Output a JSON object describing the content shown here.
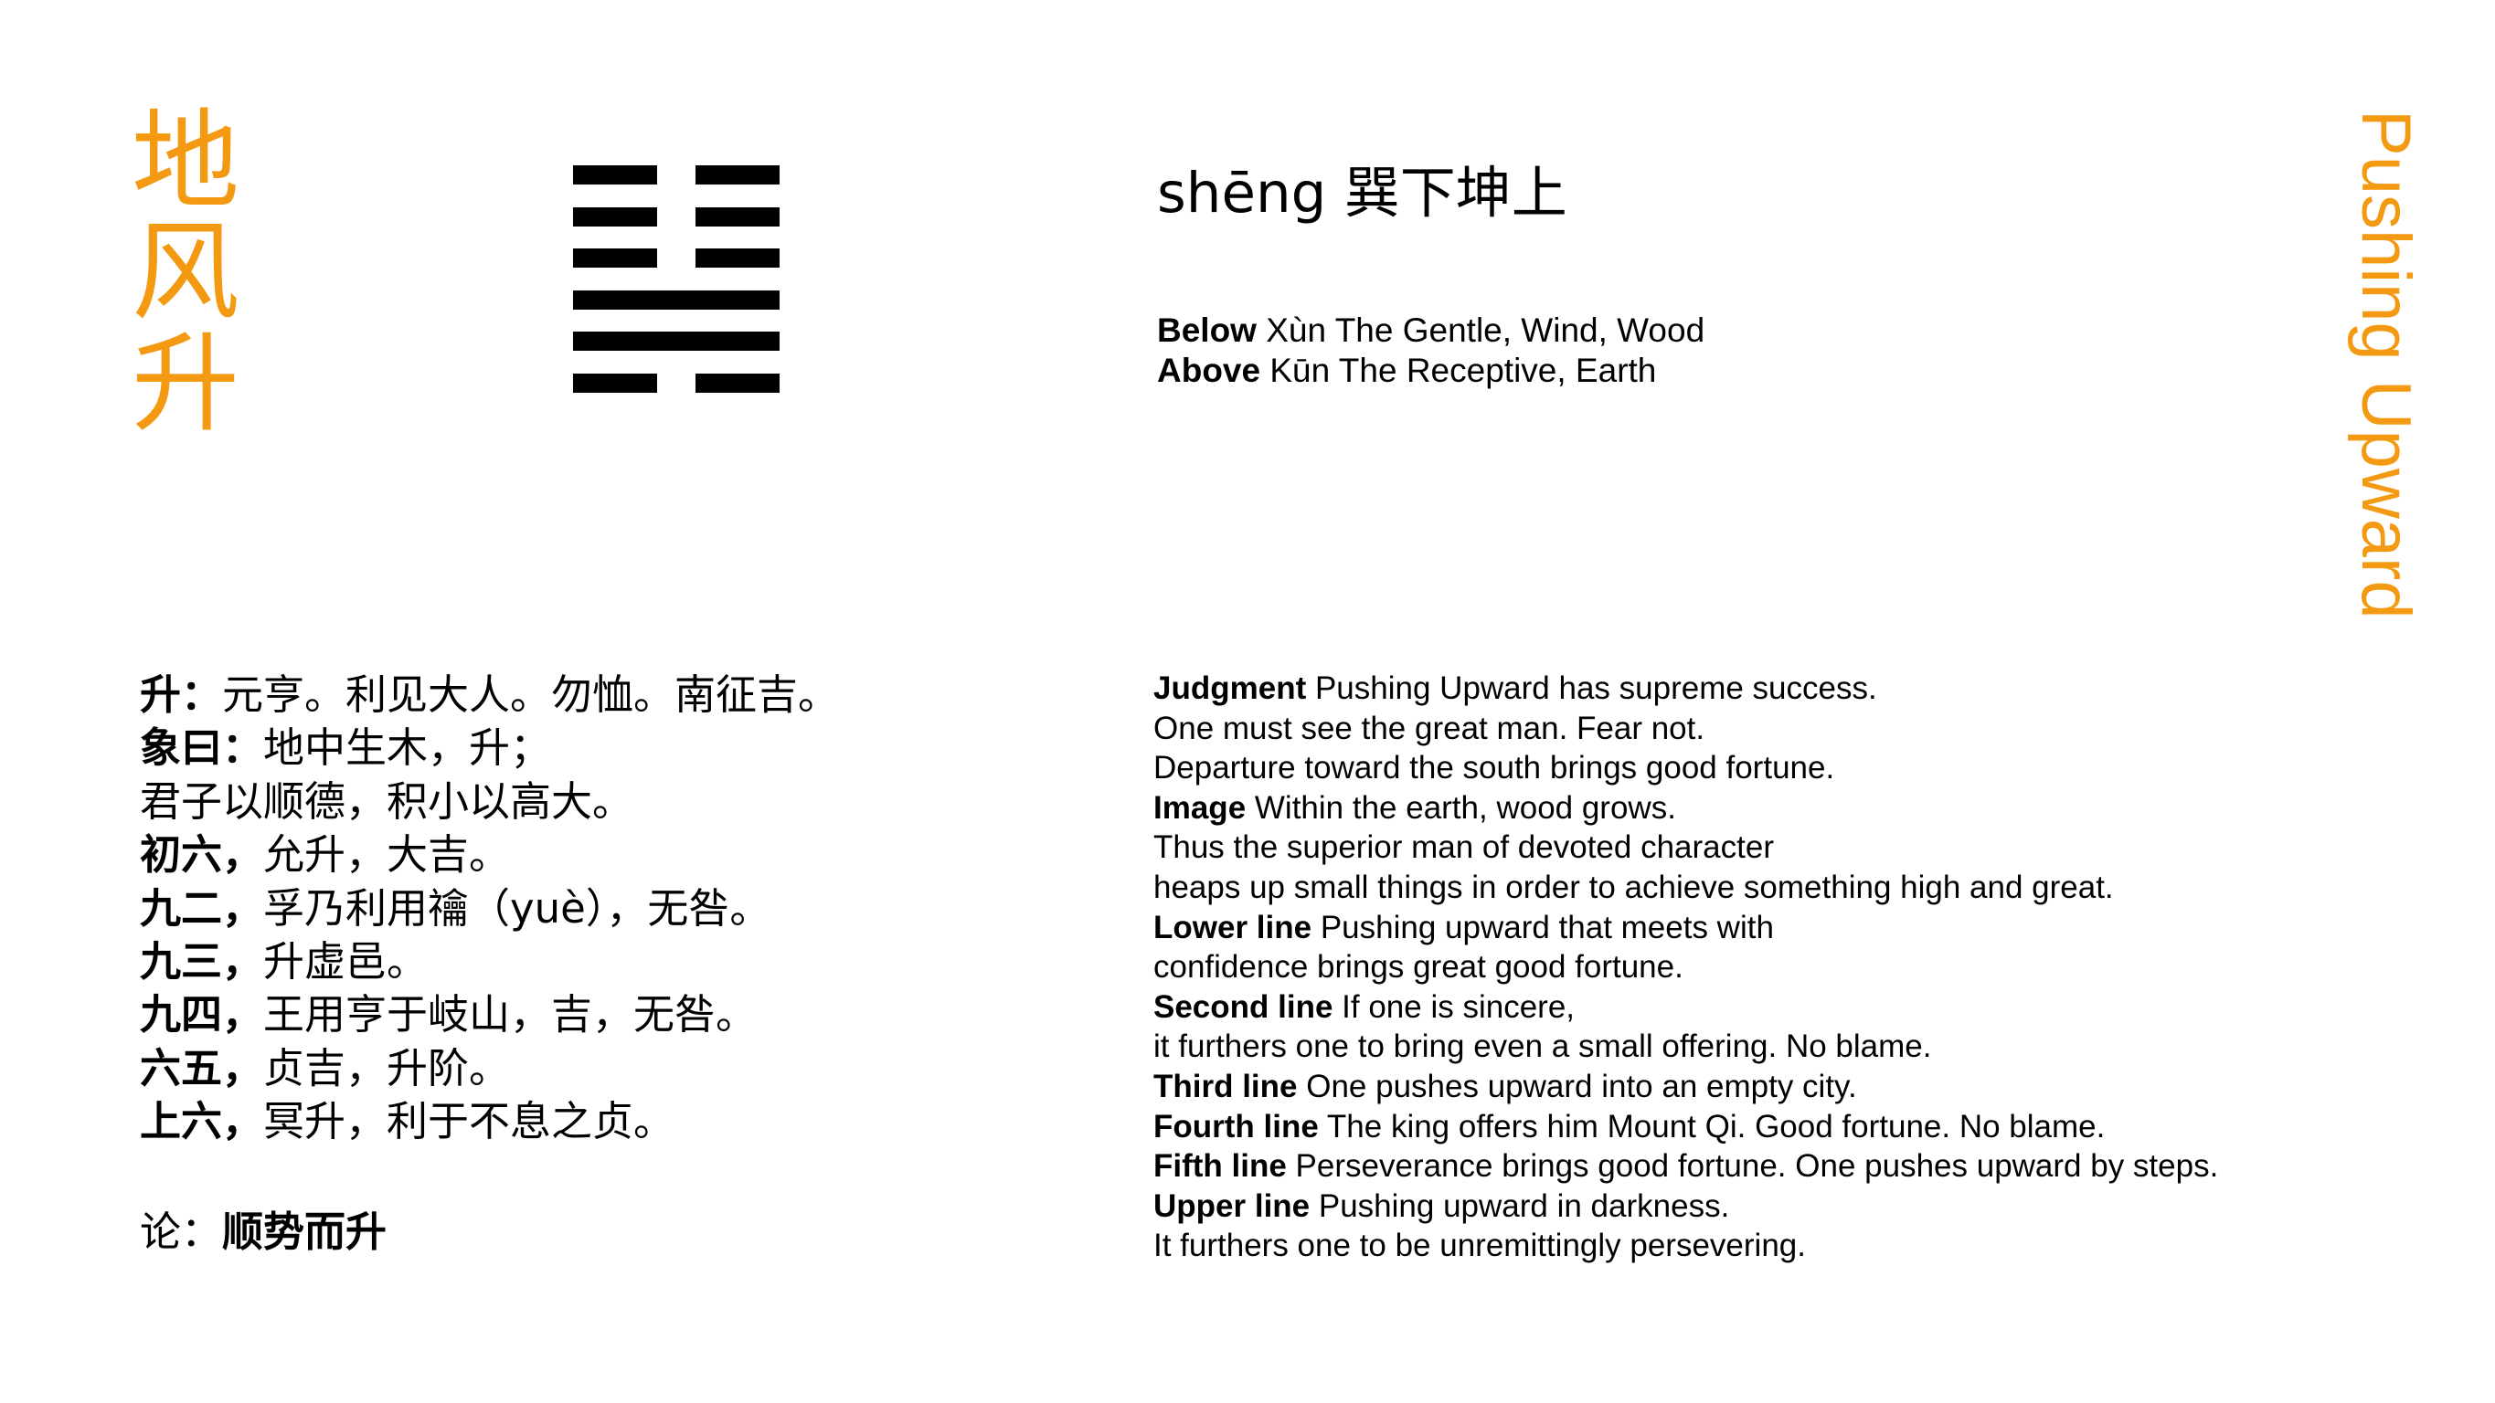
{
  "title_cn": [
    "地",
    "风",
    "升"
  ],
  "title_en": "Pushing Upward",
  "header": {
    "pinyin": "shēng",
    "trigram_name": "巽下坤上"
  },
  "hexagram": {
    "lines_top_to_bottom": [
      "broken",
      "broken",
      "broken",
      "solid",
      "solid",
      "broken"
    ]
  },
  "trigrams": {
    "below_label": "Below",
    "below_text": "Xùn The Gentle, Wind, Wood",
    "above_label": "Above",
    "above_text": "Kūn The Receptive, Earth"
  },
  "chinese_text": [
    {
      "label": "升：",
      "text": "元亨。利见大人。勿恤。南征吉。"
    },
    {
      "label": "象曰：",
      "text": "地中生木，升；"
    },
    {
      "label": "",
      "text": "君子以顺德，积小以高大。"
    },
    {
      "label": "初六，",
      "text": "允升，大吉。"
    },
    {
      "label": "九二，",
      "text": "孚乃利用禴（yuè），无咎。"
    },
    {
      "label": "九三，",
      "text": "升虚邑。"
    },
    {
      "label": "九四，",
      "text": "王用亨于岐山，吉，无咎。"
    },
    {
      "label": "六五，",
      "text": "贞吉，升阶。"
    },
    {
      "label": "上六，",
      "text": "冥升，利于不息之贞。"
    }
  ],
  "conclusion": {
    "label": "论：",
    "text": "顺势而升"
  },
  "english_text": [
    {
      "label": "Judgment",
      "text": " Pushing Upward has supreme success."
    },
    {
      "label": "",
      "text": "One must see the great man. Fear not."
    },
    {
      "label": "",
      "text": "Departure toward the south brings good fortune."
    },
    {
      "label": "Image",
      "text": " Within the earth, wood grows."
    },
    {
      "label": "",
      "text": "Thus the superior man of devoted character"
    },
    {
      "label": "",
      "text": "heaps up small things in order to achieve something high and great."
    },
    {
      "label": "Lower line",
      "text": " Pushing upward that meets with"
    },
    {
      "label": "",
      "text": "confidence brings great good fortune."
    },
    {
      "label": "Second line",
      "text": " If one is sincere,"
    },
    {
      "label": "",
      "text": "it furthers one to bring even a small offering. No blame."
    },
    {
      "label": "Third line",
      "text": " One pushes upward into an empty city."
    },
    {
      "label": "Fourth line",
      "text": " The king offers him Mount Qi. Good fortune. No blame."
    },
    {
      "label": "Fifth line",
      "text": " Perseverance brings good fortune. One pushes upward by steps."
    },
    {
      "label": "Upper line",
      "text": " Pushing upward in darkness."
    },
    {
      "label": "",
      "text": "It furthers one to be unremittingly persevering."
    }
  ],
  "colors": {
    "accent": "#F39A12",
    "text": "#000000",
    "background": "#ffffff"
  }
}
